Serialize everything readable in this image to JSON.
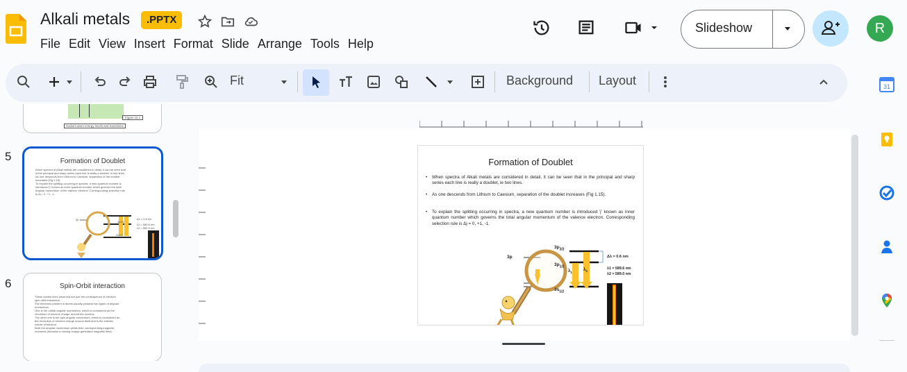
{
  "header": {
    "doc_title": "Alkali metals",
    "extension_badge": ".PPTX",
    "menus": [
      "File",
      "Edit",
      "View",
      "Insert",
      "Format",
      "Slide",
      "Arrange",
      "Tools",
      "Help"
    ],
    "slideshow_label": "Slideshow",
    "avatar_initial": "R"
  },
  "toolbar": {
    "zoom_label": "Fit",
    "background_label": "Background",
    "layout_label": "Layout"
  },
  "filmstrip": {
    "slide4": {
      "caption_1": "Sodium atom energy levels and transitions",
      "caption_2": "Figure 16.1"
    },
    "slide5": {
      "number": "5",
      "title": "Formation of Doublet",
      "lines": [
        "When spectra of Alkali metals are considered in detail, it can be seen that",
        "in the principal and sharp series each line is really a doublet, ie two lines.",
        "As one descends from Lithium to Caesium, separation of the doublet",
        "increases (Fig 1.15).",
        "To explain the splitting occurring in spectra, a new quantum number is",
        "introduced 'j' known as inner quantum number which governs the total",
        "angular momentum of the valence electron. Corresponding selection rule",
        "is Δj = 0, +1, -1."
      ],
      "labels": {
        "l3p": "3p",
        "l3p32": "3p3/2",
        "l3s12": "3s1/2",
        "dl": "Δλ = 0.6 nm",
        "w1": "λ1 = 589.6 nm",
        "w2": "λ2 = 589.0 nm"
      }
    },
    "slide6": {
      "number": "6",
      "title": "Spin-Orbit interaction",
      "lines": [
        "These double lines observed are just the consequence of electron",
        "spin orbit interaction.",
        "The electrons present in atoms usually possess two types of angular",
        "momentum.",
        "One is the orbital angular momentum, which is considered as the",
        "revolution of electron charge around the nucleus.",
        "The other one is the spin angular momentum, which is considered as",
        "the revolution of electron charge around itself and is the intrinsic",
        "nature of electron.",
        "Both the angular momentum yields their corresponding magnetic",
        "moments (because a moving charge generates magnetic field)."
      ]
    }
  },
  "slide": {
    "title": "Formation of Doublet",
    "bullet_1": "When spectra of Alkali metals are considered in detail, it can be seen that in the principal and sharp series each line is really a doublet, ie two lines.",
    "bullet_2": "As one descends from Lithium to Caesium, separation of the doublet increases (Fig 1.15).",
    "bullet_3": "To explain the splitting occurring in spectra, a new quantum number is introduced 'j' known as inner quantum number which governs the total angular momentum of the valence electron. Corresponding selection rule is Δj = 0, +1, -1.",
    "diagram": {
      "label_3p": "3p",
      "label_3p_32": "3p",
      "sub_3p_32": "3/2",
      "label_3p_12": "3p",
      "sub_3p_12": "1/2",
      "label_3s": "3s",
      "sub_3s": "1/2",
      "lambda1": "λ",
      "lambda1_sub": "1",
      "lambda2": "λ",
      "lambda2_sub": "2",
      "delta": "Δλ = 0.6 nm",
      "wl1": "λ1 = 589.6 nm",
      "wl2": "λ2 = 589.0 nm"
    }
  },
  "colors": {
    "accent_blue": "#0b57d0",
    "badge_yellow": "#fbbc04",
    "avatar_green": "#34a853",
    "share_bg": "#c2e7ff"
  }
}
